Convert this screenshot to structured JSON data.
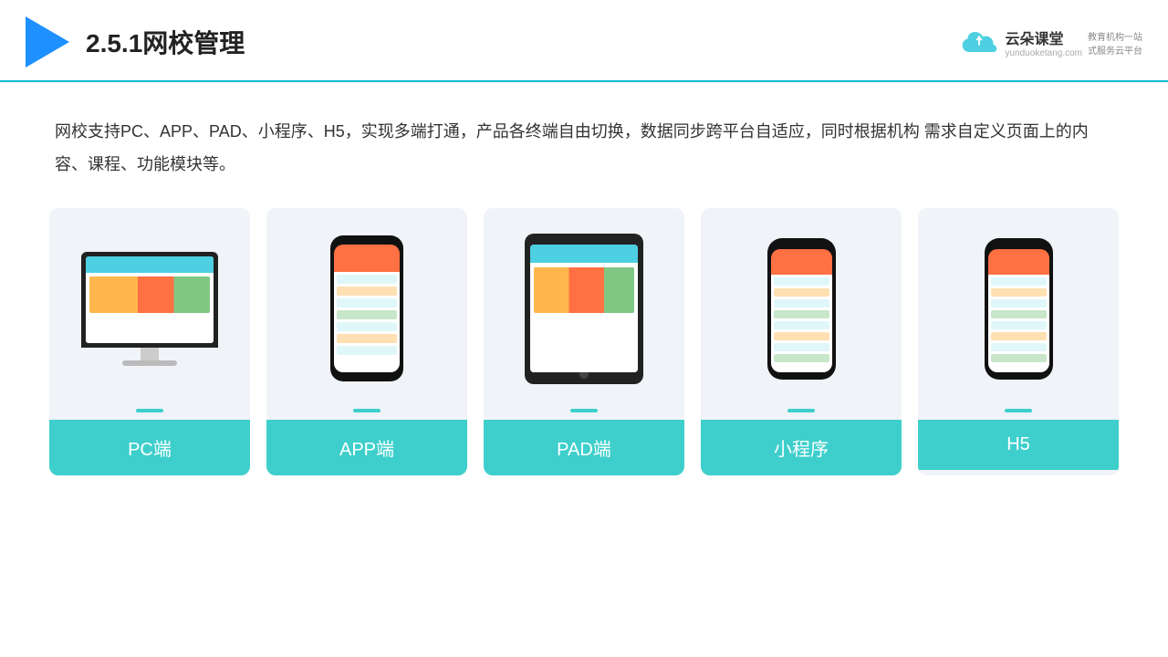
{
  "header": {
    "title": "2.5.1网校管理",
    "brand_name": "云朵课堂",
    "brand_url": "yunduoketang.com",
    "brand_slogan": "教育机构一站\n式服务云平台"
  },
  "description": {
    "text": "网校支持PC、APP、PAD、小程序、H5，实现多端打通，产品各终端自由切换，数据同步跨平台自适应，同时根据机构\n需求自定义页面上的内容、课程、功能模块等。"
  },
  "cards": [
    {
      "label": "PC端"
    },
    {
      "label": "APP端"
    },
    {
      "label": "PAD端"
    },
    {
      "label": "小程序"
    },
    {
      "label": "H5"
    }
  ]
}
